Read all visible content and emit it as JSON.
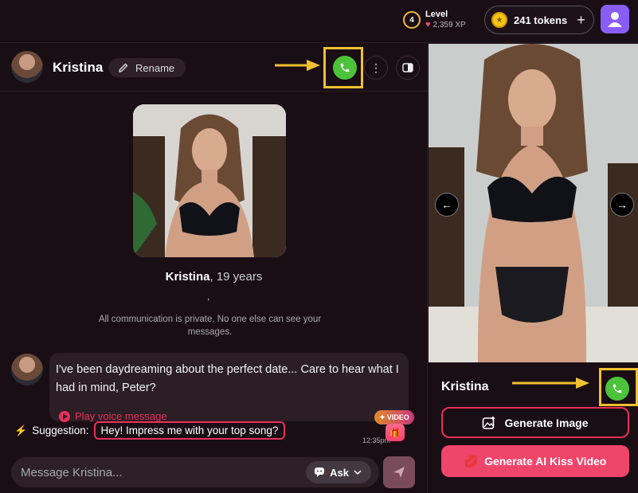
{
  "topbar": {
    "level_number": "4",
    "level_label": "Level",
    "xp": "2,359 XP",
    "tokens_label": "241 tokens",
    "plus": "+"
  },
  "chat": {
    "header": {
      "name": "Kristina",
      "rename_label": "Rename"
    },
    "profile": {
      "name": "Kristina",
      "age": ", 19 years",
      "separator": ",",
      "privacy": "All communication is private. No one else can see your messages."
    },
    "message": {
      "text": "I've been daydreaming about the perfect date... Care to hear what I had in mind, Peter?",
      "voice_label": "Play voice message",
      "time": "12:35pm"
    },
    "suggestion": {
      "label": "Suggestion:",
      "text": "Hey! Impress me with your top song?"
    },
    "video_badge": "VIDEO",
    "input": {
      "placeholder": "Message Kristina...",
      "ask_label": "Ask"
    }
  },
  "right": {
    "name": "Kristina",
    "generate_image_label": "Generate Image",
    "generate_kiss_label": "Generate AI Kiss Video"
  },
  "colors": {
    "background": "#1a0e15",
    "accent": "#e8305a",
    "call_green": "#4cc33a",
    "highlight": "#f0c030"
  }
}
